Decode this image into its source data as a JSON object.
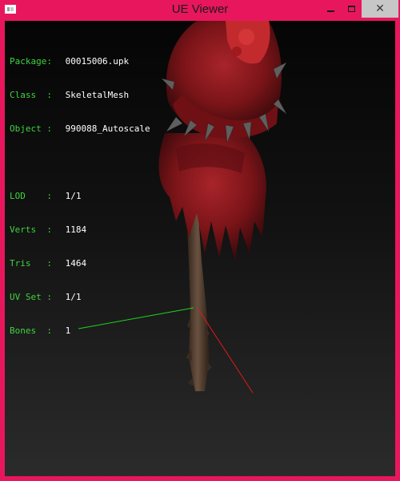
{
  "window": {
    "title": "UE Viewer",
    "accent_color": "#e8175d"
  },
  "controls": {
    "minimize_icon": "minimize-icon",
    "maximize_icon": "maximize-icon",
    "close_icon": "close-icon",
    "close_glyph": "✕"
  },
  "info": {
    "package": {
      "label": "Package:",
      "value": "00015006.upk"
    },
    "class": {
      "label": "Class  :",
      "value": "SkeletalMesh"
    },
    "object": {
      "label": "Object :",
      "value": "990088_Autoscale"
    },
    "lod": {
      "label": "LOD    :",
      "value": "1/1"
    },
    "verts": {
      "label": "Verts  :",
      "value": "1184"
    },
    "tris": {
      "label": "Tris   :",
      "value": "1464"
    },
    "uvset": {
      "label": "UV Set :",
      "value": "1/1"
    },
    "bones": {
      "label": "Bones  :",
      "value": "1"
    },
    "label_color": "#3ed43e"
  }
}
